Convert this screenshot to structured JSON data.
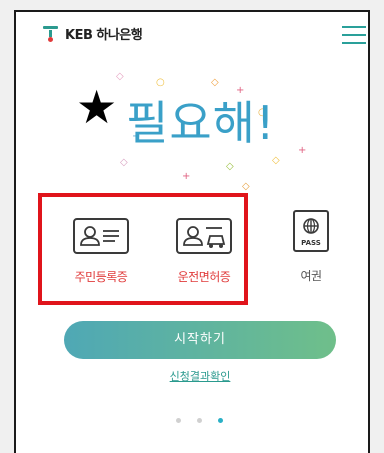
{
  "header": {
    "brand": "KEB 하나은행",
    "logo_icon": "hana-logo-icon",
    "menu_icon": "hamburger-menu-icon",
    "accent_color": "#2aa09a"
  },
  "hero": {
    "title": "필요해!",
    "star": "★",
    "title_color": "#3aa0c8"
  },
  "id_options": [
    {
      "label": "주민등록증",
      "icon": "id-card-icon"
    },
    {
      "label": "운전면허증",
      "icon": "driver-license-icon"
    },
    {
      "label": "여권",
      "icon": "passport-icon",
      "badge": "PASS"
    }
  ],
  "highlight_color": "#e0141b",
  "start_button": {
    "label": "시작하기"
  },
  "check_link": {
    "label": "신청결과확인"
  },
  "pagination": {
    "count": 3,
    "active_index": 2
  }
}
